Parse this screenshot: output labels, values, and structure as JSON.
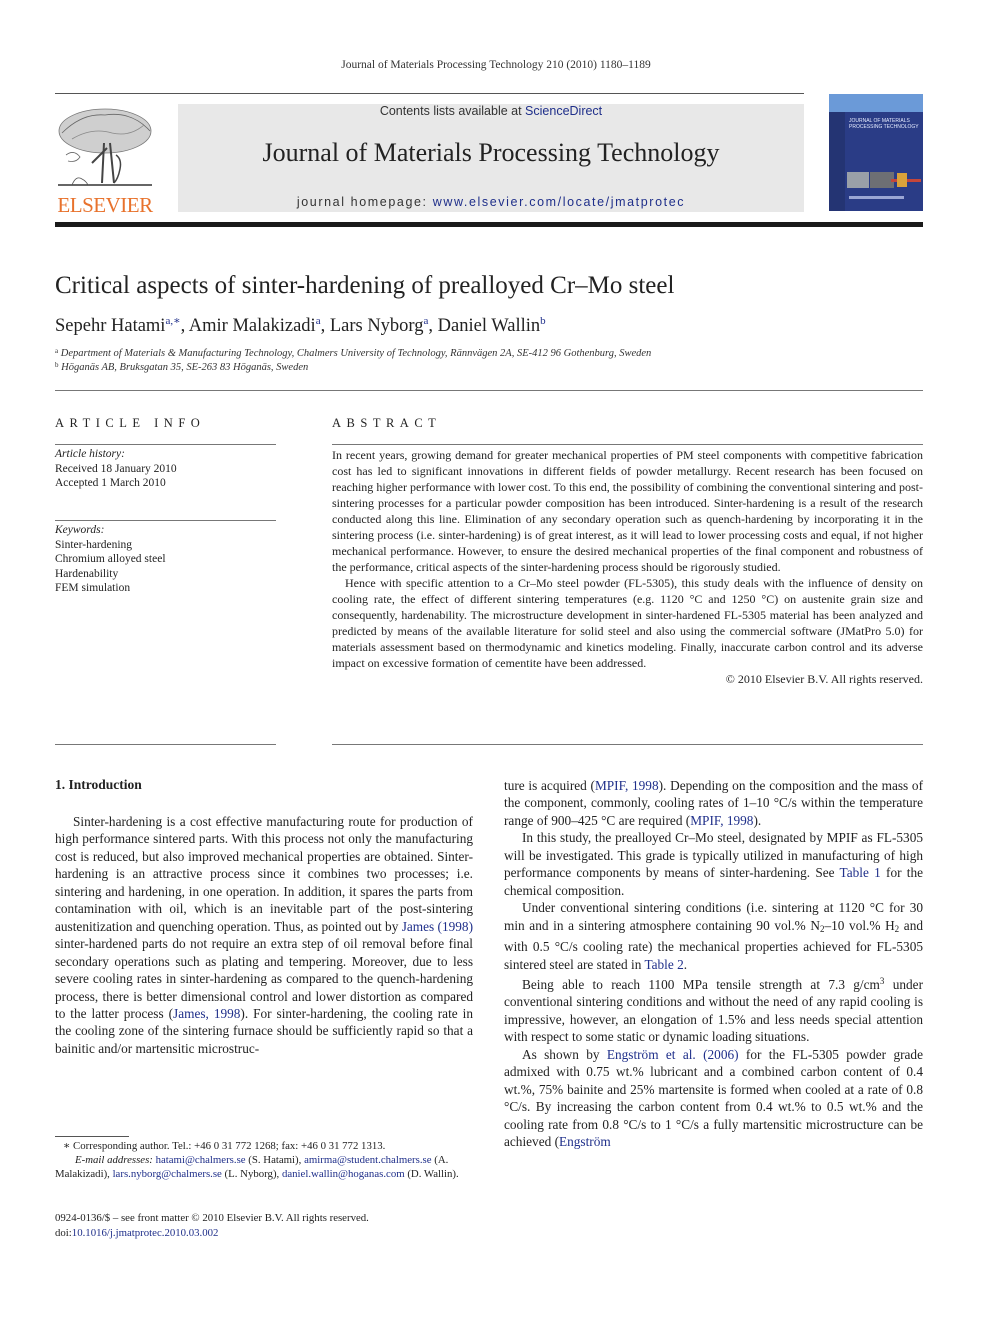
{
  "running_head": "Journal of Materials Processing Technology 210 (2010) 1180–1189",
  "publisher": {
    "logo_text": "ELSEVIER",
    "logo_color": "#e8722c"
  },
  "masthead": {
    "contents_prefix": "Contents lists available at ",
    "contents_link": "ScienceDirect",
    "journal_title": "Journal of Materials Processing Technology",
    "homepage_prefix": "journal homepage: ",
    "homepage_link": "www.elsevier.com/locate/jmatprotec"
  },
  "cover": {
    "title_line1": "JOURNAL OF MATERIALS",
    "title_line2": "PROCESSING TECHNOLOGY"
  },
  "article": {
    "title": "Critical aspects of sinter-hardening of prealloyed Cr–Mo steel",
    "authors": [
      {
        "name": "Sepehr Hatami",
        "sup": "a,∗"
      },
      {
        "name": "Amir Malakizadi",
        "sup": "a"
      },
      {
        "name": "Lars Nyborg",
        "sup": "a"
      },
      {
        "name": "Daniel Wallin",
        "sup": "b"
      }
    ],
    "affiliations": [
      {
        "mark": "a",
        "text": "Department of Materials & Manufacturing Technology, Chalmers University of Technology, Rännvägen 2A, SE-412 96 Gothenburg, Sweden"
      },
      {
        "mark": "b",
        "text": "Höganäs AB, Bruksgatan 35, SE-263 83 Höganäs, Sweden"
      }
    ]
  },
  "article_info": {
    "heading": "ARTICLE INFO",
    "history_label": "Article history:",
    "received": "Received 18 January 2010",
    "accepted": "Accepted 1 March 2010",
    "keywords_label": "Keywords:",
    "keywords": [
      "Sinter-hardening",
      "Chromium alloyed steel",
      "Hardenability",
      "FEM simulation"
    ]
  },
  "abstract": {
    "heading": "ABSTRACT",
    "paragraphs": [
      "In recent years, growing demand for greater mechanical properties of PM steel components with competitive fabrication cost has led to significant innovations in different fields of powder metallurgy. Recent research has been focused on reaching higher performance with lower cost. To this end, the possibility of combining the conventional sintering and post-sintering processes for a particular powder composition has been introduced. Sinter-hardening is a result of the research conducted along this line. Elimination of any secondary operation such as quench-hardening by incorporating it in the sintering process (i.e. sinter-hardening) is of great interest, as it will lead to lower processing costs and equal, if not higher mechanical performance. However, to ensure the desired mechanical properties of the final component and robustness of the performance, critical aspects of the sinter-hardening process should be rigorously studied.",
      "Hence with specific attention to a Cr–Mo steel powder (FL-5305), this study deals with the influence of density on cooling rate, the effect of different sintering temperatures (e.g. 1120 °C and 1250 °C) on austenite grain size and consequently, hardenability. The microstructure development in sinter-hardened FL-5305 material has been analyzed and predicted by means of the available literature for solid steel and also using the commercial software (JMatPro 5.0) for materials assessment based on thermodynamic and kinetics modeling. Finally, inaccurate carbon control and its adverse impact on excessive formation of cementite have been addressed."
    ],
    "copyright": "© 2010 Elsevier B.V. All rights reserved."
  },
  "introduction": {
    "heading": "1.  Introduction",
    "left_p1_a": "Sinter-hardening is a cost effective manufacturing route for production of high performance sintered parts. With this process not only the manufacturing cost is reduced, but also improved mechanical properties are obtained. Sinter-hardening is an attractive process since it combines two processes; i.e. sintering and hardening, in one operation. In addition, it spares the parts from contamination with oil, which is an inevitable part of the post-sintering austenitization and quenching operation. Thus, as pointed out by ",
    "left_p1_link1": "James (1998)",
    "left_p1_b": " sinter-hardened parts do not require an extra step of oil removal before final secondary operations such as plating and tempering. Moreover, due to less severe cooling rates in sinter-hardening as compared to the quench-hardening process, there is better dimensional control and lower distortion as compared to the latter process (",
    "left_p1_link2": "James, 1998",
    "left_p1_c": "). For sinter-hardening, the cooling rate in the cooling zone of the sintering furnace should be sufficiently rapid so that a bainitic and/or martensitic microstruc-",
    "right_p1_a": "ture is acquired (",
    "right_p1_link1": "MPIF, 1998",
    "right_p1_b": "). Depending on the composition and the mass of the component, commonly, cooling rates of 1–10 °C/s within the temperature range of 900–425 °C are required (",
    "right_p1_link2": "MPIF, 1998",
    "right_p1_c": ").",
    "right_p2_a": "In this study, the prealloyed Cr–Mo steel, designated by MPIF as FL-5305 will be investigated. This grade is typically utilized in manufacturing of high performance components by means of sinter-hardening. See ",
    "right_p2_link": "Table 1",
    "right_p2_b": " for the chemical composition.",
    "right_p3_a": "Under conventional sintering conditions (i.e. sintering at 1120 °C for 30 min and in a sintering atmosphere containing 90 vol.% N",
    "right_p3_sub1": "2",
    "right_p3_b": "–10 vol.% H",
    "right_p3_sub2": "2",
    "right_p3_c": " and with 0.5 °C/s cooling rate) the mechanical properties achieved for FL-5305 sintered steel are stated in ",
    "right_p3_link": "Table 2",
    "right_p3_d": ".",
    "right_p4_a": "Being able to reach 1100 MPa tensile strength at 7.3 g/cm",
    "right_p4_sup": "3",
    "right_p4_b": " under conventional sintering conditions and without the need of any rapid cooling is impressive, however, an elongation of 1.5% and less needs special attention with respect to some static or dynamic loading situations.",
    "right_p5_a": "As shown by ",
    "right_p5_link1": "Engström et al. (2006)",
    "right_p5_b": " for the FL-5305 powder grade admixed with 0.75 wt.% lubricant and a combined carbon content of 0.4 wt.%, 75% bainite and 25% martensite is formed when cooled at a rate of 0.8 °C/s. By increasing the carbon content from 0.4 wt.% to 0.5 wt.% and the cooling rate from 0.8 °C/s to 1 °C/s a fully martensitic microstructure can be achieved (",
    "right_p5_link2": "Engström"
  },
  "footnotes": {
    "corresponding": "∗ Corresponding author. Tel.: +46 0 31 772 1268; fax: +46 0 31 772 1313.",
    "email_label": "E-mail addresses:",
    "emails": [
      {
        "address": "hatami@chalmers.se",
        "who": " (S. Hatami),"
      },
      {
        "address": "amirma@student.chalmers.se",
        "who": " (A. Malakizadi), "
      },
      {
        "address": "lars.nyborg@chalmers.se",
        "who": " (L. Nyborg),"
      },
      {
        "address": "daniel.wallin@hoganas.com",
        "who": " (D. Wallin)."
      }
    ],
    "issn": "0924-0136/$ – see front matter © 2010 Elsevier B.V. All rights reserved.",
    "doi_prefix": "doi:",
    "doi": "10.1016/j.jmatprotec.2010.03.002"
  }
}
